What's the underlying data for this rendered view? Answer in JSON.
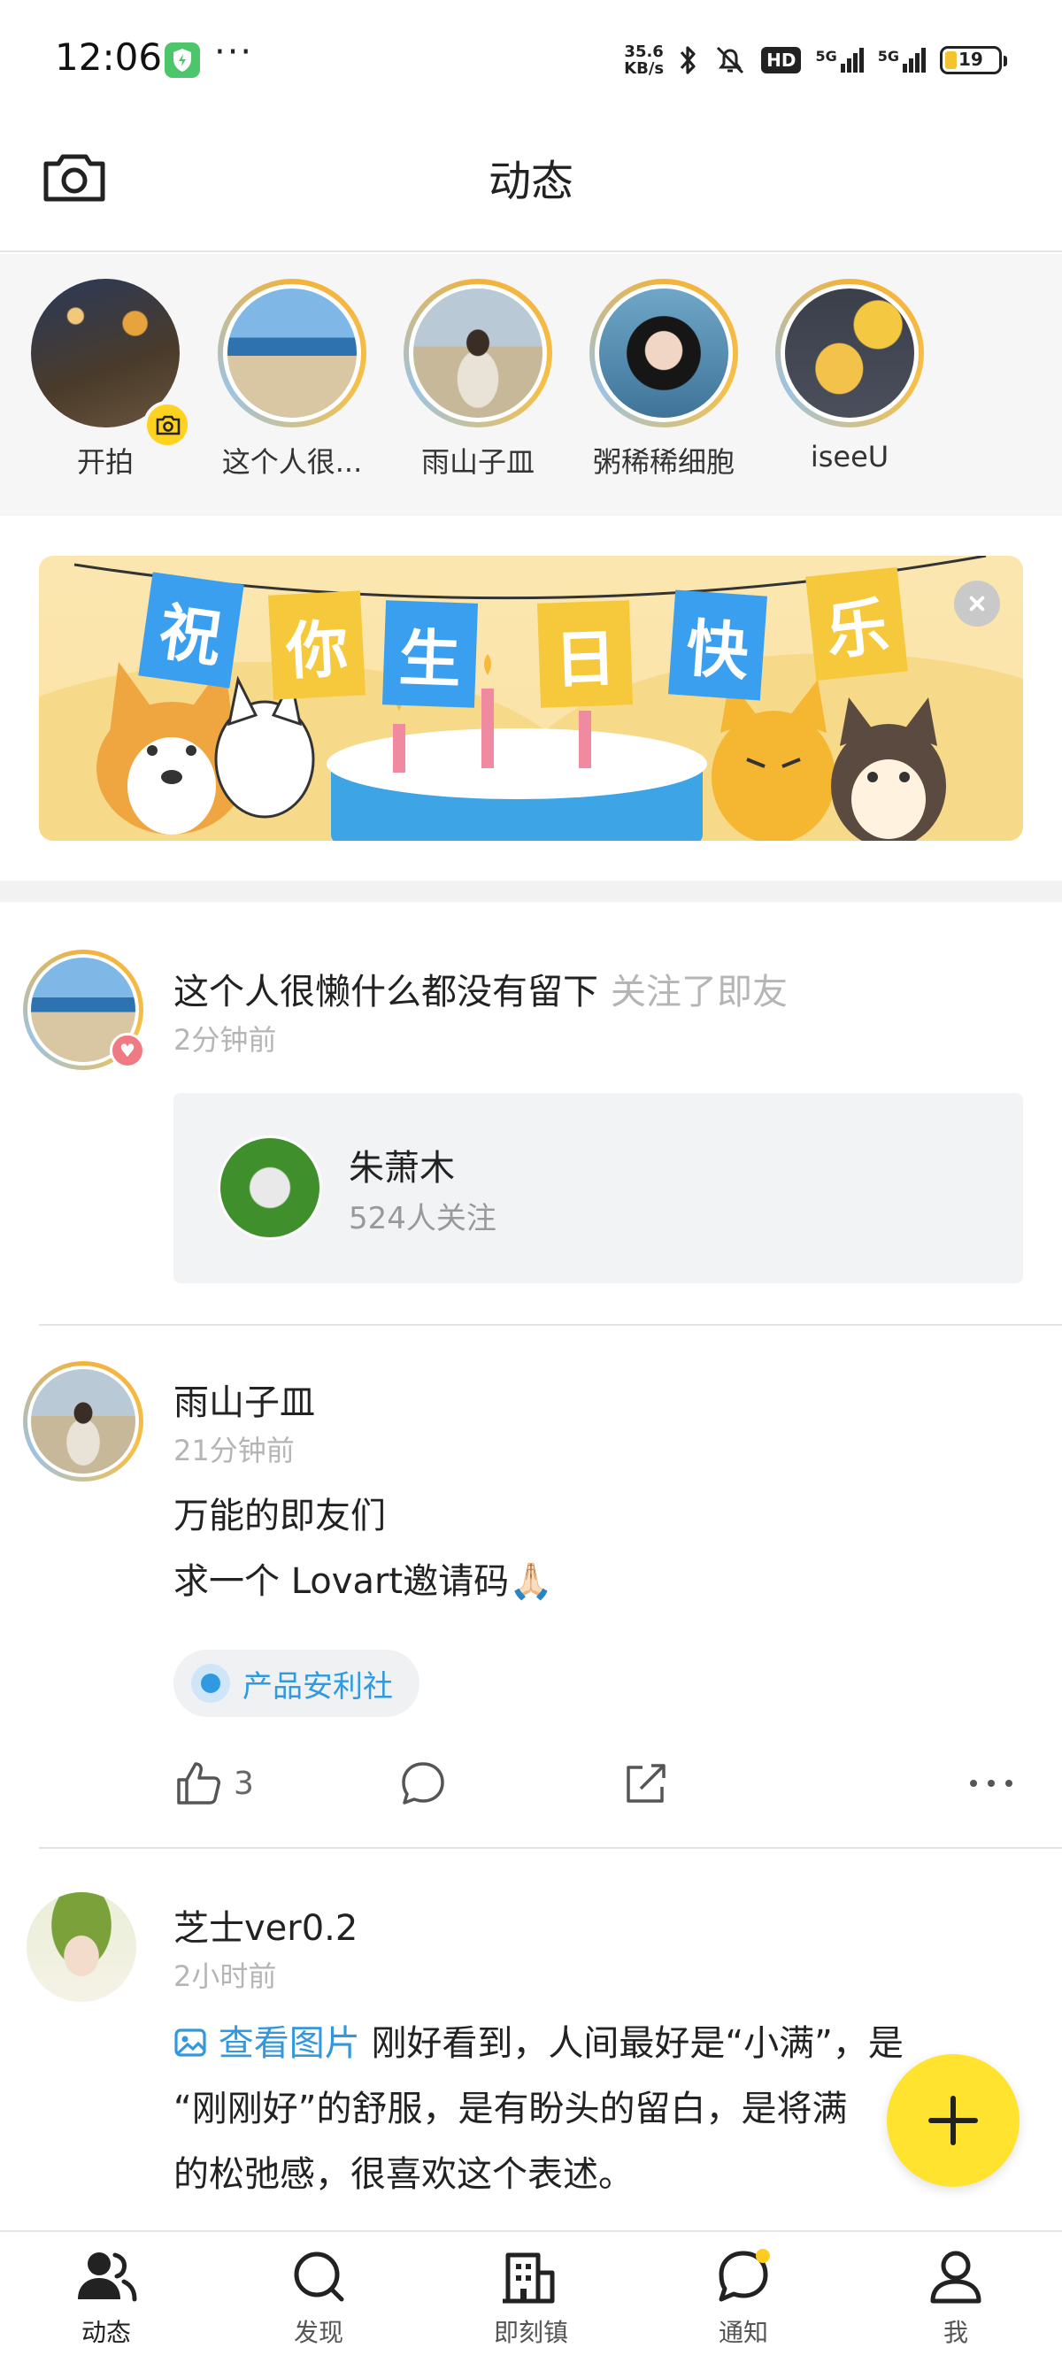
{
  "status_bar": {
    "time": "12:06",
    "more": "···",
    "speed_value": "35.6",
    "speed_unit": "KB/s",
    "hd": "HD",
    "signal_1": "5G",
    "signal_2": "5G",
    "battery": "19"
  },
  "header": {
    "title": "动态"
  },
  "stories": [
    {
      "name": "开拍"
    },
    {
      "name": "这个人很..."
    },
    {
      "name": "雨山子皿"
    },
    {
      "name": "粥稀稀细胞"
    },
    {
      "name": "iseeU"
    }
  ],
  "banner": {
    "flags": [
      "祝",
      "你",
      "生",
      "日",
      "快",
      "乐"
    ]
  },
  "posts": [
    {
      "author": "这个人很懒什么都没有留下",
      "action": "关注了即友",
      "time": "2分钟前",
      "followed": {
        "name": "朱萧木",
        "followers": "524人关注"
      }
    },
    {
      "author": "雨山子皿",
      "time": "21分钟前",
      "lines": [
        "万能的即友们",
        "求一个 Lovart邀请码🙏🏻"
      ],
      "topic": "产品安利社",
      "likes": "3"
    },
    {
      "author": "芝士ver0.2",
      "time": "2小时前",
      "image_link": "查看图片",
      "lines": [
        "刚好看到，人间最好是“小满”，是",
        "“刚刚好”的舒服，是有盼头的留白，是将满",
        "的松弛感，很喜欢这个表述。"
      ]
    }
  ],
  "bottom_nav": [
    {
      "label": "动态"
    },
    {
      "label": "发现"
    },
    {
      "label": "即刻镇"
    },
    {
      "label": "通知"
    },
    {
      "label": "我"
    }
  ],
  "colors": {
    "accent_yellow": "#ffe32e",
    "link_blue": "#3397dd",
    "muted_gray": "#b5b5b5"
  }
}
